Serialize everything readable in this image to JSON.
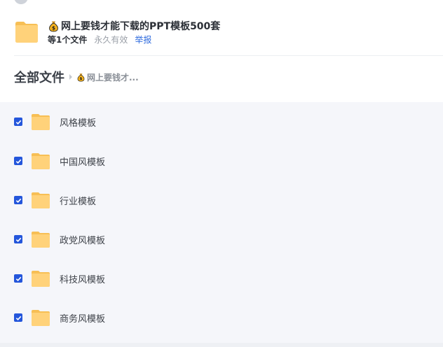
{
  "share": {
    "title": "网上要钱才能下载的PPT模板500套",
    "file_count": "等1个文件",
    "validity": "永久有效",
    "report": "举报"
  },
  "breadcrumb": {
    "root": "全部文件",
    "current": "网上要钱才..."
  },
  "files": [
    {
      "name": "风格模板",
      "checked": true
    },
    {
      "name": "中国风模板",
      "checked": true
    },
    {
      "name": "行业模板",
      "checked": true
    },
    {
      "name": "政党风模板",
      "checked": true
    },
    {
      "name": "科技风模板",
      "checked": true
    },
    {
      "name": "商务风模板",
      "checked": true
    }
  ],
  "colors": {
    "accent": "#2456db",
    "link": "#2f6bde",
    "folder": "#ffd27a",
    "list_bg": "#f5f6fa"
  },
  "icons": {
    "title_icon": "money-bag-icon",
    "folder_icon": "folder-icon",
    "checkbox_icon": "checkmark-icon"
  }
}
